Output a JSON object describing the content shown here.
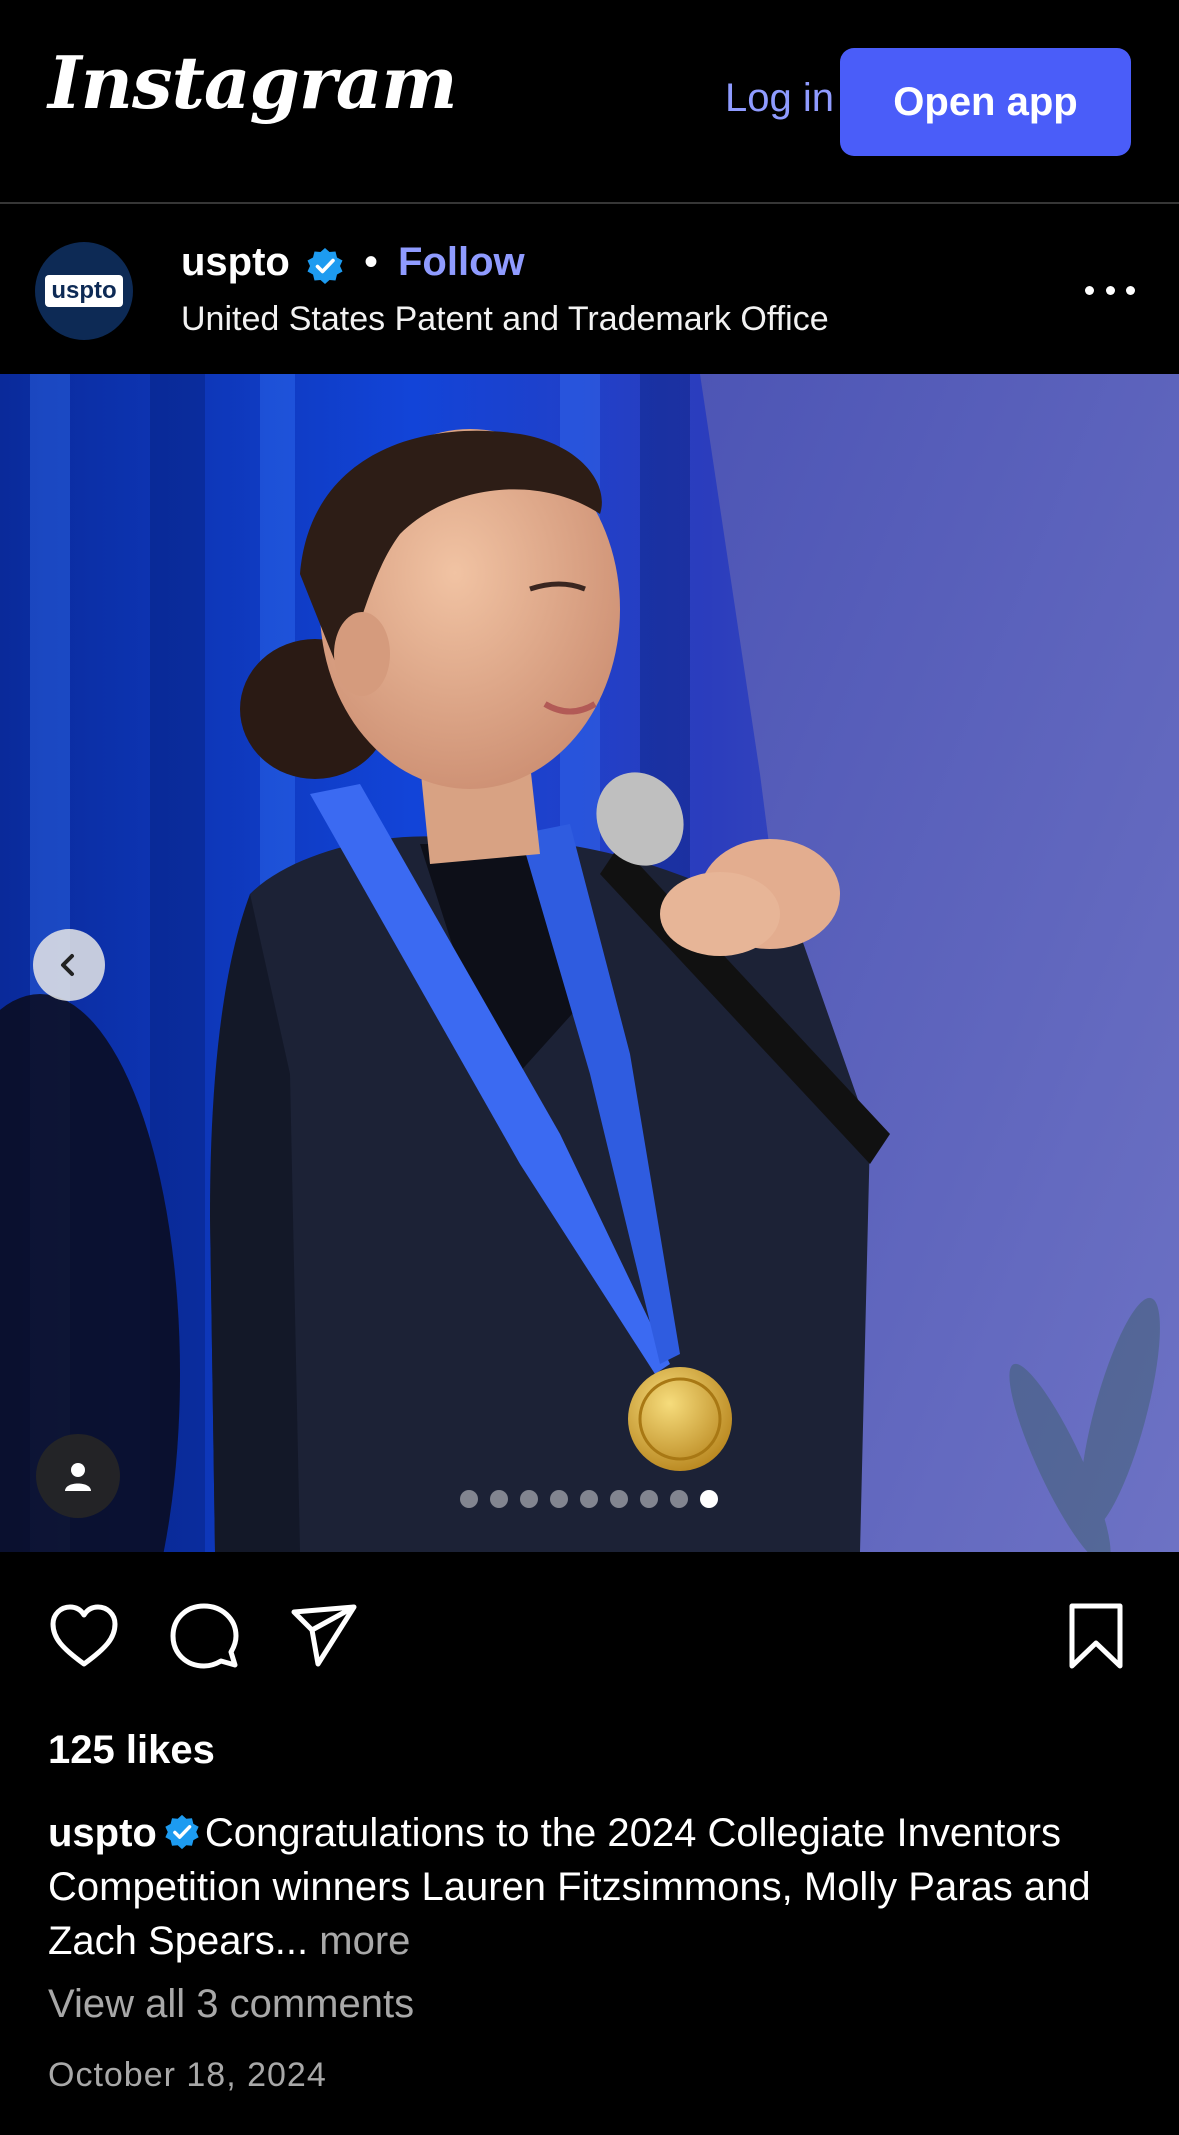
{
  "topbar": {
    "logo": "Instagram",
    "login_label": "Log in",
    "open_app_label": "Open app"
  },
  "post": {
    "username": "uspto",
    "avatar_text": "uspto",
    "separator": "•",
    "follow_label": "Follow",
    "subtitle": "United States Patent and Trademark Office",
    "carousel": {
      "total": 9,
      "active_index": 8
    },
    "likes": "125 likes",
    "caption": {
      "username": "uspto",
      "text": "Congratulations to the 2024 Collegiate Inventors Competition winners Lauren Fitzsimmons, Molly Paras and Zach Spears...",
      "more_label": "more"
    },
    "comments_link": "View all 3 comments",
    "date": "October 18, 2024"
  },
  "colors": {
    "accent": "#4a5df9",
    "link": "#8f9bff",
    "verified": "#1d9bf0",
    "muted": "#a8a8a8"
  },
  "icons": {
    "verified": "verified-badge-icon",
    "more": "more-horizontal-icon",
    "prev": "chevron-left-icon",
    "tag": "user-tag-icon",
    "like": "heart-icon",
    "comment": "comment-icon",
    "share": "send-icon",
    "save": "bookmark-icon"
  }
}
